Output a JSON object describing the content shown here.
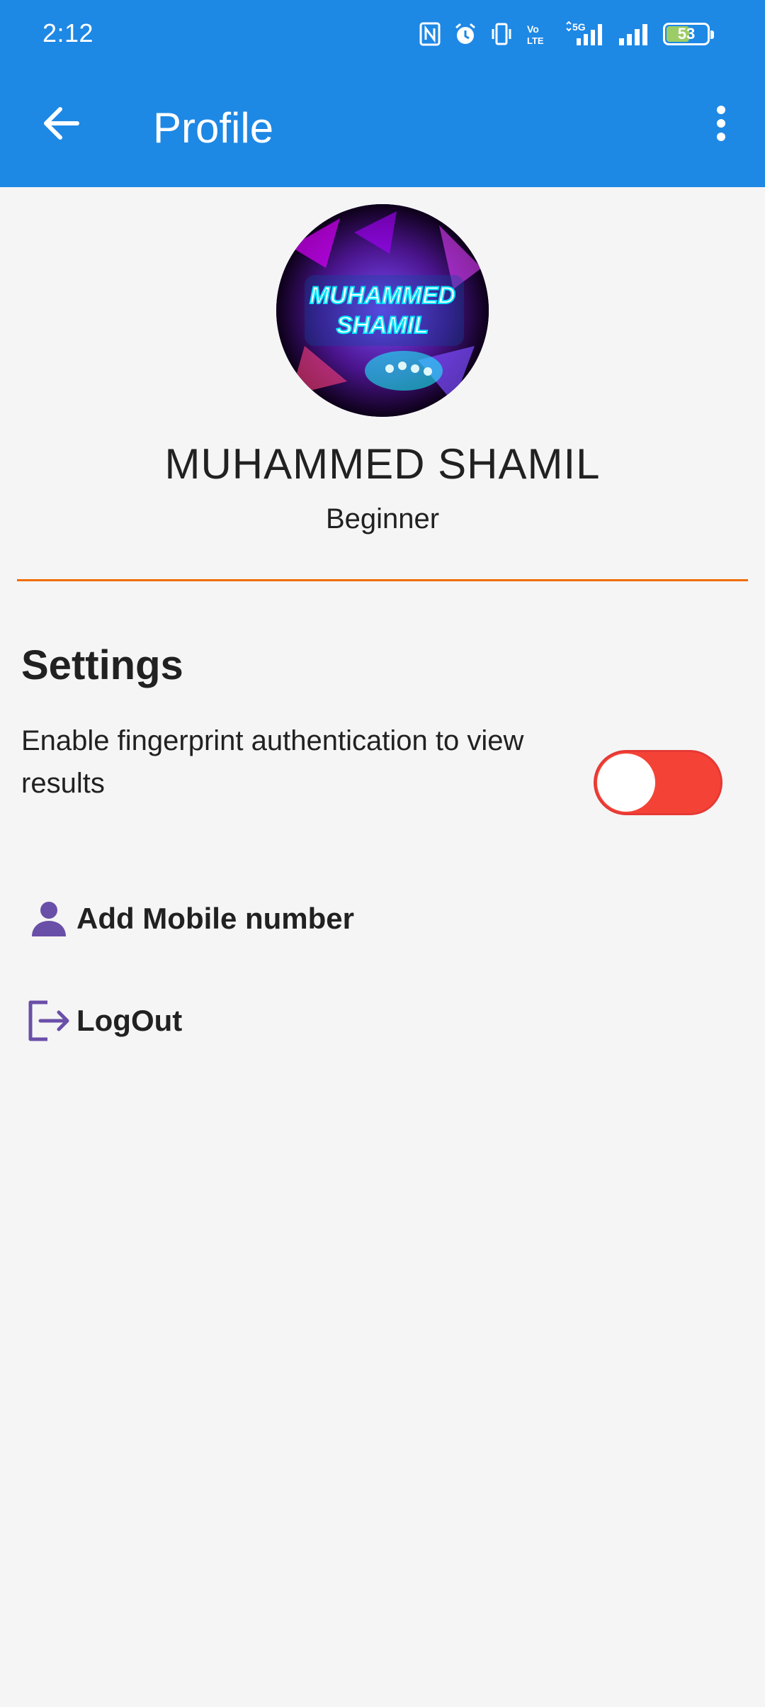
{
  "status_bar": {
    "time": "2:12",
    "battery_level": "53",
    "icons": [
      "nfc-icon",
      "alarm-icon",
      "vibrate-icon",
      "volte-icon",
      "signal-5g-icon",
      "signal-icon",
      "battery-icon"
    ]
  },
  "app_bar": {
    "title": "Profile",
    "back_icon": "arrow-back-icon",
    "more_icon": "more-vert-icon"
  },
  "profile": {
    "avatar_text_line1": "MUHAMMED",
    "avatar_text_line2": "SHAMIL",
    "name": "MUHAMMED SHAMIL",
    "level": "Beginner"
  },
  "settings": {
    "heading": "Settings",
    "fingerprint_label": "Enable fingerprint authentication to view results",
    "fingerprint_enabled": false
  },
  "menu": {
    "items": [
      {
        "label": "Add Mobile number",
        "icon": "person-icon"
      },
      {
        "label": "LogOut",
        "icon": "logout-icon"
      }
    ]
  },
  "colors": {
    "app_bar": "#1e88e5",
    "background": "#f5f5f5",
    "divider": "#ef6c00",
    "toggle_track": "#f44336",
    "icon_accent": "#6a4fa8"
  }
}
